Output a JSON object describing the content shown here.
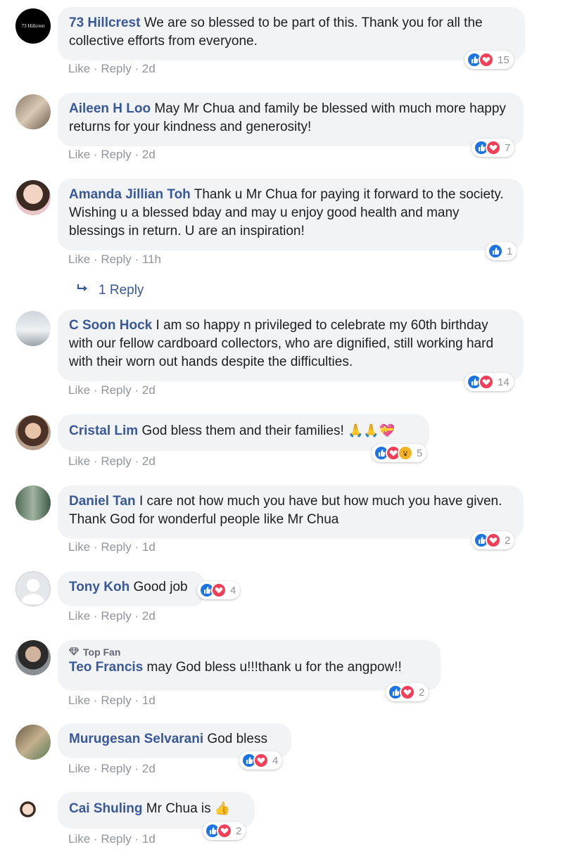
{
  "comments": [
    {
      "author": "73 Hillcrest",
      "text": "We are so blessed to be part of this. Thank you for all the collective efforts from everyone.",
      "reply_label": "Reply",
      "like_label": "Like",
      "time": "2d",
      "reaction_count": "15",
      "avatar_label": "73 Hillcrest"
    },
    {
      "author": "Aileen H Loo",
      "text": "May Mr Chua and family be blessed with much more happy returns for your kindness and generosity!",
      "like_label": "Like",
      "reply_label": "Reply",
      "time": "2d",
      "reaction_count": "7"
    },
    {
      "author": "Amanda Jillian Toh",
      "text": "Thank u Mr Chua for paying it forward to the society. Wishing u a blessed bday and may u enjoy good health and many blessings in return. U are an inspiration!",
      "like_label": "Like",
      "reply_label": "Reply",
      "time": "11h",
      "reaction_count": "1",
      "replies_label": "1 Reply"
    },
    {
      "author": "C Soon Hock",
      "text": "I am so happy n privileged to celebrate my 60th birthday with our fellow cardboard collectors, who are dignified, still working hard with their worn out hands despite the difficulties.",
      "like_label": "Like",
      "reply_label": "Reply",
      "time": "2d",
      "reaction_count": "14"
    },
    {
      "author": "Cristal Lim",
      "text": "God bless them and their families!",
      "emoji": "🙏🙏💝",
      "like_label": "Like",
      "reply_label": "Reply",
      "time": "2d",
      "reaction_count": "5"
    },
    {
      "author": "Daniel Tan",
      "text": "I care not how much you have but how much you have given. Thank God for wonderful people like Mr Chua",
      "like_label": "Like",
      "reply_label": "Reply",
      "time": "1d",
      "reaction_count": "2"
    },
    {
      "author": "Tony Koh",
      "text": "Good job",
      "like_label": "Like",
      "reply_label": "Reply",
      "time": "2d",
      "reaction_count": "4"
    },
    {
      "badge": "Top Fan",
      "author": "Teo Francis",
      "text": "may God bless u!!!thank u for the angpow!!",
      "like_label": "Like",
      "reply_label": "Reply",
      "time": "1d",
      "reaction_count": "2"
    },
    {
      "author": "Murugesan Selvarani",
      "text": "God bless",
      "like_label": "Like",
      "reply_label": "Reply",
      "time": "2d",
      "reaction_count": "4"
    },
    {
      "author": "Cai Shuling",
      "text": "Mr Chua is",
      "emoji": "👍",
      "like_label": "Like",
      "reply_label": "Reply",
      "time": "1d",
      "reaction_count": "2"
    }
  ],
  "separator": "·",
  "colors": {
    "author": "#385898",
    "bubble": "#f2f3f5",
    "meta": "#90949c",
    "like": "#1b74e4",
    "love": "#f33e58",
    "wow": "#f7b125"
  }
}
